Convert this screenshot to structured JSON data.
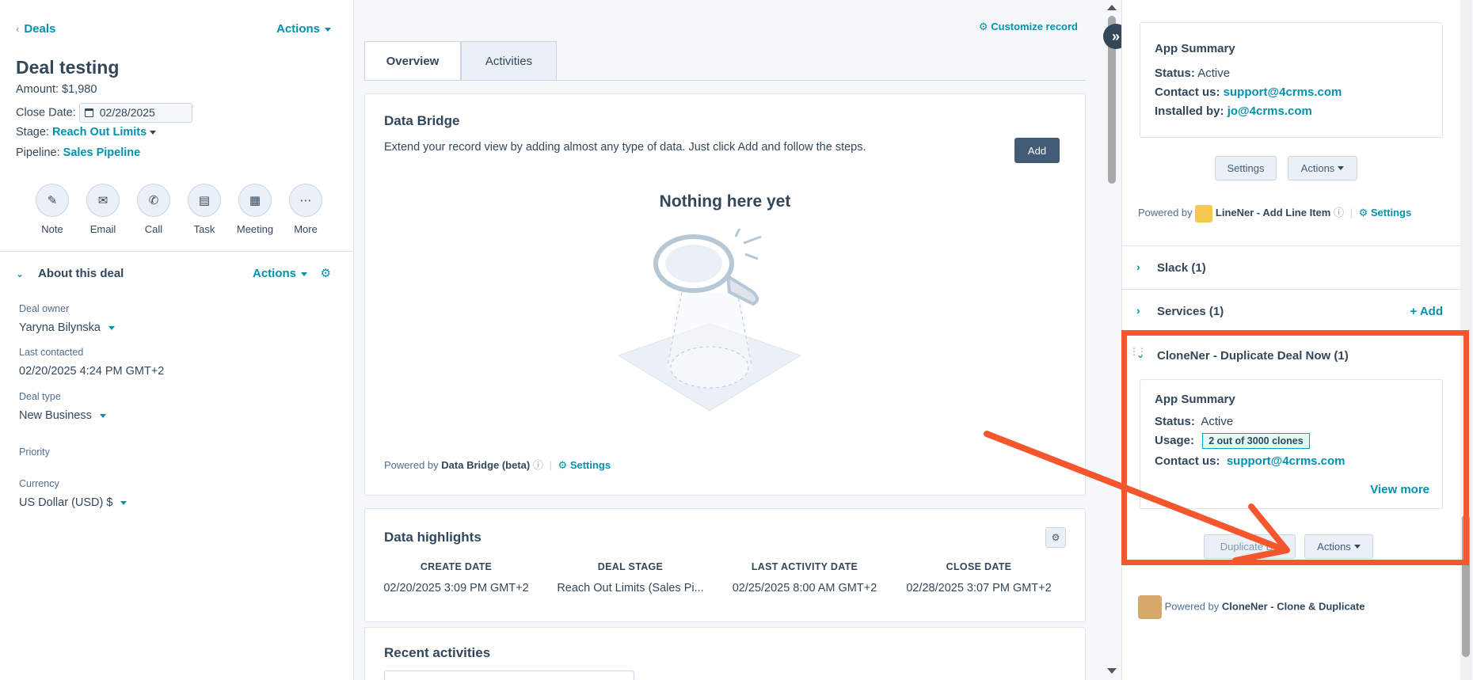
{
  "left": {
    "back_label": "Deals",
    "actions_label": "Actions",
    "deal_title": "Deal testing",
    "amount_label": "Amount:",
    "amount_value": "$1,980",
    "close_date_label": "Close Date:",
    "close_date_value": "02/28/2025",
    "stage_label": "Stage:",
    "stage_value": "Reach Out Limits",
    "pipeline_label": "Pipeline:",
    "pipeline_value": "Sales Pipeline",
    "quick_actions": [
      {
        "label": "Note",
        "icon": "note-icon"
      },
      {
        "label": "Email",
        "icon": "email-icon"
      },
      {
        "label": "Call",
        "icon": "call-icon"
      },
      {
        "label": "Task",
        "icon": "task-icon"
      },
      {
        "label": "Meeting",
        "icon": "meeting-icon"
      },
      {
        "label": "More",
        "icon": "more-icon"
      }
    ],
    "about": {
      "title": "About this deal",
      "actions_label": "Actions",
      "fields": [
        {
          "label": "Deal owner",
          "value": "Yaryna Bilynska"
        },
        {
          "label": "Last contacted",
          "value": "02/20/2025 4:24 PM GMT+2"
        },
        {
          "label": "Deal type",
          "value": "New Business"
        },
        {
          "label": "Priority",
          "value": ""
        },
        {
          "label": "Currency",
          "value": "US Dollar (USD) $"
        }
      ]
    }
  },
  "middle": {
    "customize_label": "Customize record",
    "tabs": [
      {
        "label": "Overview"
      },
      {
        "label": "Activities"
      }
    ],
    "data_bridge": {
      "title": "Data Bridge",
      "description": "Extend your record view by adding almost any type of data. Just click Add and follow the steps.",
      "add_label": "Add",
      "empty_title": "Nothing here yet",
      "powered_prefix": "Powered by",
      "powered_name": "Data Bridge (beta)",
      "settings_label": "Settings"
    },
    "highlights": {
      "title": "Data highlights",
      "columns": [
        {
          "header": "CREATE DATE",
          "value": "02/20/2025 3:09 PM GMT+2"
        },
        {
          "header": "DEAL STAGE",
          "value": "Reach Out Limits (Sales Pi..."
        },
        {
          "header": "LAST ACTIVITY DATE",
          "value": "02/25/2025 8:00 AM GMT+2"
        },
        {
          "header": "CLOSE DATE",
          "value": "02/28/2025 3:07 PM GMT+2"
        }
      ]
    },
    "recent_title": "Recent activities"
  },
  "right": {
    "linener": {
      "summary_title": "App Summary",
      "status_label": "Status:",
      "status_value": "Active",
      "contact_label": "Contact us:",
      "contact_value": "support@4crms.com",
      "installed_label": "Installed by:",
      "installed_value": "jo@4crms.com",
      "settings_btn": "Settings",
      "actions_btn": "Actions",
      "powered_prefix": "Powered by",
      "powered_name": "LineNer - Add Line Item",
      "settings_link": "Settings"
    },
    "slack": {
      "title": "Slack (1)"
    },
    "services": {
      "title": "Services (1)",
      "add_label": "+ Add"
    },
    "cloner": {
      "title": "CloneNer - Duplicate Deal Now (1)",
      "summary_title": "App Summary",
      "status_label": "Status:",
      "status_value": "Active",
      "usage_label": "Usage:",
      "usage_value": "2 out of 3000 clones",
      "contact_label": "Contact us:",
      "contact_value": "support@4crms.com",
      "view_more": "View more",
      "duplicate_btn": "Duplicate De",
      "actions_btn": "Actions",
      "powered_prefix": "Powered by",
      "powered_name": "CloneNer - Clone & Duplicate"
    }
  },
  "colors": {
    "accent": "#0091ae",
    "primary_button": "#425b76",
    "annotation": "#f4562e"
  }
}
